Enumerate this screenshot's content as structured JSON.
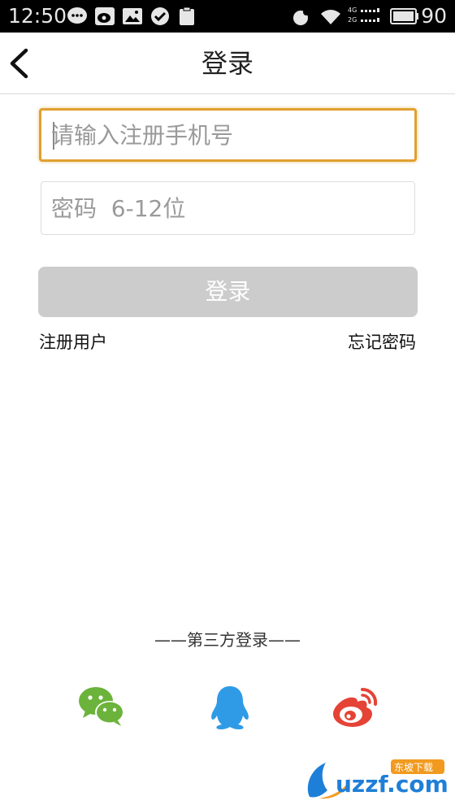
{
  "status_bar": {
    "time": "12:50",
    "battery": "90",
    "network": "4G",
    "network_2": "2G"
  },
  "header": {
    "title": "登录"
  },
  "form": {
    "phone_placeholder": "请输入注册手机号",
    "password_placeholder": "密码  6-12位",
    "login_label": "登录"
  },
  "links": {
    "register": "注册用户",
    "forgot_password": "忘记密码"
  },
  "third_party": {
    "title": "——第三方登录——",
    "providers": [
      "wechat",
      "qq",
      "weibo"
    ]
  },
  "watermark": {
    "text": "uzzf.com",
    "tag": "东坡下载"
  },
  "colors": {
    "focus_border": "#e0a030",
    "login_button_disabled": "#cccccc",
    "wechat": "#6bb33b",
    "qq": "#2f9be6",
    "weibo": "#e54336"
  }
}
